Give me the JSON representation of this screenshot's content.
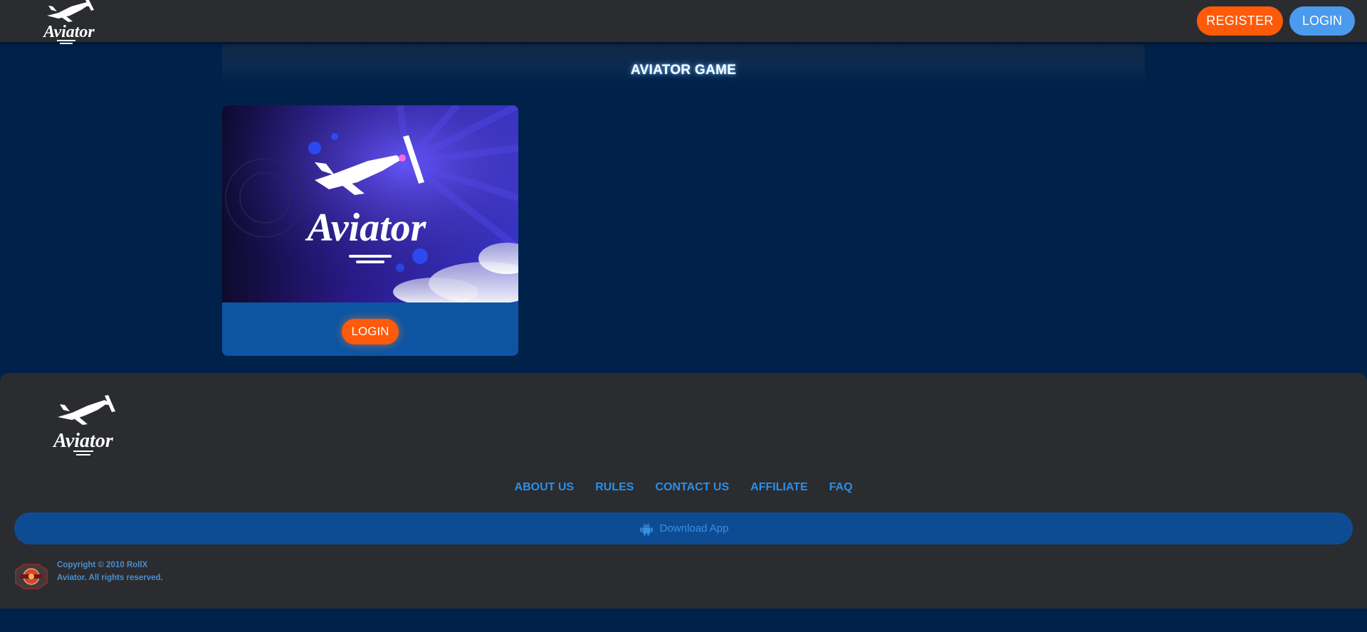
{
  "header": {
    "logo_text": "Aviator",
    "register_label": "REGISTER",
    "login_label": "LOGIN"
  },
  "main": {
    "title": "AVIATOR GAME",
    "game_card": {
      "thumb_logo_text": "Aviator",
      "login_label": "LOGIN"
    }
  },
  "footer": {
    "logo_text": "Aviator",
    "links": [
      "ABOUT US",
      "RULES",
      "CONTACT US",
      "AFFILIATE",
      "FAQ"
    ],
    "download_label": "Download App",
    "copyright": "Copyright © 2010 RollX Aviator. All rights reserved."
  },
  "colors": {
    "page_background": "#00214a",
    "header_background": "#2a2c2f",
    "register_orange": "#ff5a0a",
    "login_blue": "#4a9aee",
    "card_blue": "#0d55a3",
    "link_blue": "#2a8fe8"
  },
  "icons": {
    "header_logo": "aviator-plane-logo",
    "footer_logo": "aviator-plane-logo",
    "download": "android-icon",
    "seal": "certification-seal-icon"
  }
}
